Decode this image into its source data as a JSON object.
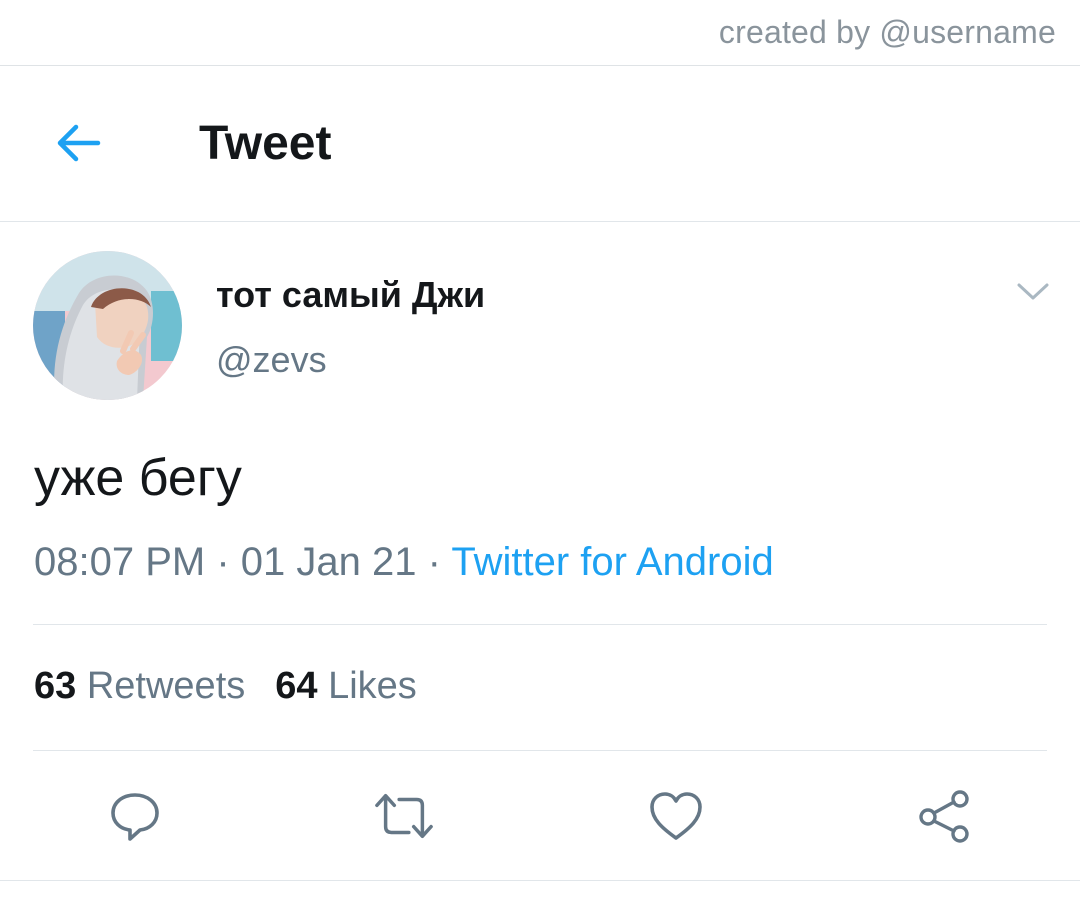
{
  "credit": {
    "text": "created by @username"
  },
  "header": {
    "title": "Tweet",
    "back_icon": "arrow-left-icon"
  },
  "tweet": {
    "author": {
      "display_name": "тот самый Джи",
      "handle": "@zevs"
    },
    "text": "уже бегу",
    "time": "08:07 PM",
    "separator": "·",
    "date": "01 Jan 21",
    "source": "Twitter for Android",
    "stats": {
      "retweets_count": "63",
      "retweets_label": "Retweets",
      "likes_count": "64",
      "likes_label": "Likes"
    }
  },
  "actions": {
    "reply_icon": "speech-bubble-icon",
    "retweet_icon": "retweet-arrows-icon",
    "like_icon": "heart-icon",
    "share_icon": "share-nodes-icon"
  },
  "colors": {
    "accent": "#1da1f2",
    "text_primary": "#14171a",
    "text_secondary": "#657786",
    "icon_gray": "#657786",
    "divider": "#e1e6ea"
  }
}
